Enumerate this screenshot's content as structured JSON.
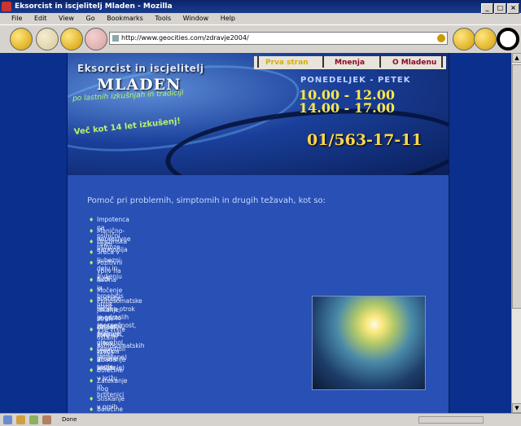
{
  "window": {
    "title": "Eksorcist in iscjelitelj Mladen - Mozilla"
  },
  "menu": [
    "File",
    "Edit",
    "View",
    "Go",
    "Bookmarks",
    "Tools",
    "Window",
    "Help"
  ],
  "address": {
    "url": "http://www.geocities.com/zdravje2004/"
  },
  "site": {
    "nav": [
      "Prva stran",
      "Mnenja",
      "O Mladenu"
    ],
    "brand_line": "Eksorcist in iscjelitelj",
    "brand_name": "MLADEN",
    "slogan": "po lastnih izkušnjah in tradiciji",
    "days": "PONEDELJEK - PETEK",
    "hours1": "10.00 - 12.00",
    "hours2": "14.00 - 17.00",
    "experience": "Več kot 14 let izkušenj!",
    "phone": "01/563-17-11"
  },
  "content": {
    "heading": "Pomoč pri problemih, simptomih in drugih težavah, kot so:",
    "items": [
      "Impotenca na psihični ravni",
      "Manično-depresivne psihoze",
      "Družinska harmonija",
      "Sreča v ljubezni, delu in življenju",
      "Pozitivni vpliv na ljudi",
      "Astma in bronhitis otrok",
      "Močenje postelje otrok",
      "Psihosomatske težave otrok in odraslih (nespečnost, potenje,",
      "jokanje, pogosto zbujanje, živčnost, glavobol, strah, grozne sanje,",
      "strah zaradi šole ali vrtca, vročina in jecljanje)",
      "Vse vrste ostalih psihosomatskih težav",
      "Glavoboli (migrene)",
      "Zbadanje v srcu",
      "Bolečine v križu in hrbtenici",
      "Zatekanje nog",
      "Stiskanje v prsih",
      "Bolečine v želodcu"
    ]
  },
  "status": {
    "text": "Done"
  }
}
